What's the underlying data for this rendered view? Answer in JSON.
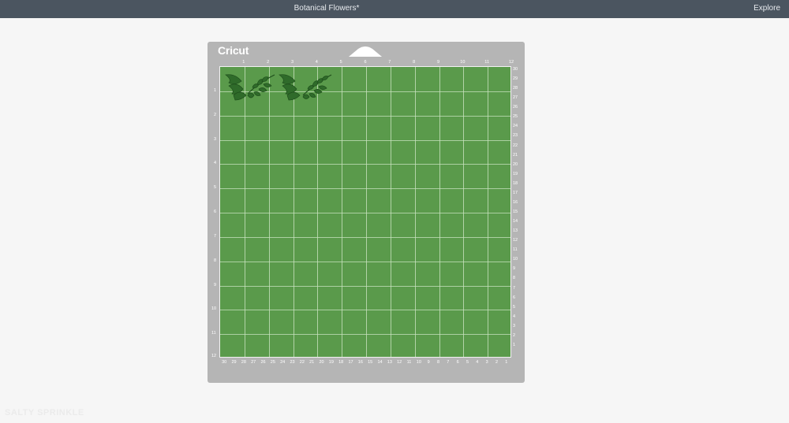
{
  "header": {
    "project_title": "Botanical Flowers*",
    "explore_label": "Explore"
  },
  "mat": {
    "brand_logo": "Cricut",
    "top_ruler": [
      "1",
      "2",
      "3",
      "4",
      "5",
      "6",
      "7",
      "8",
      "9",
      "10",
      "11",
      "12"
    ],
    "left_ruler": [
      "1",
      "2",
      "3",
      "4",
      "5",
      "6",
      "7",
      "8",
      "9",
      "10",
      "11",
      "12"
    ],
    "bottom_ruler": [
      "30",
      "29",
      "28",
      "27",
      "26",
      "25",
      "24",
      "23",
      "22",
      "21",
      "20",
      "19",
      "18",
      "17",
      "16",
      "15",
      "14",
      "13",
      "12",
      "11",
      "10",
      "9",
      "8",
      "7",
      "6",
      "5",
      "4",
      "3",
      "2",
      "1"
    ],
    "right_ruler": [
      "30",
      "29",
      "28",
      "27",
      "26",
      "25",
      "24",
      "23",
      "22",
      "21",
      "20",
      "19",
      "18",
      "17",
      "16",
      "15",
      "14",
      "13",
      "12",
      "11",
      "10",
      "9",
      "8",
      "7",
      "6",
      "5",
      "4",
      "3",
      "2",
      "1"
    ],
    "colors": {
      "mat_frame": "#b5b5b5",
      "cut_area": "#5a9a4b",
      "grid_line": "#c9e2bf",
      "leaf_dark": "#1f4f1c",
      "leaf_fill": "#2f6b2a"
    },
    "design": {
      "item_icons": [
        "fern-leaf-icon",
        "fern-leaf-icon",
        "fern-leaf-icon",
        "fern-leaf-icon"
      ]
    }
  },
  "watermark": "SALTY SPRINKLE"
}
